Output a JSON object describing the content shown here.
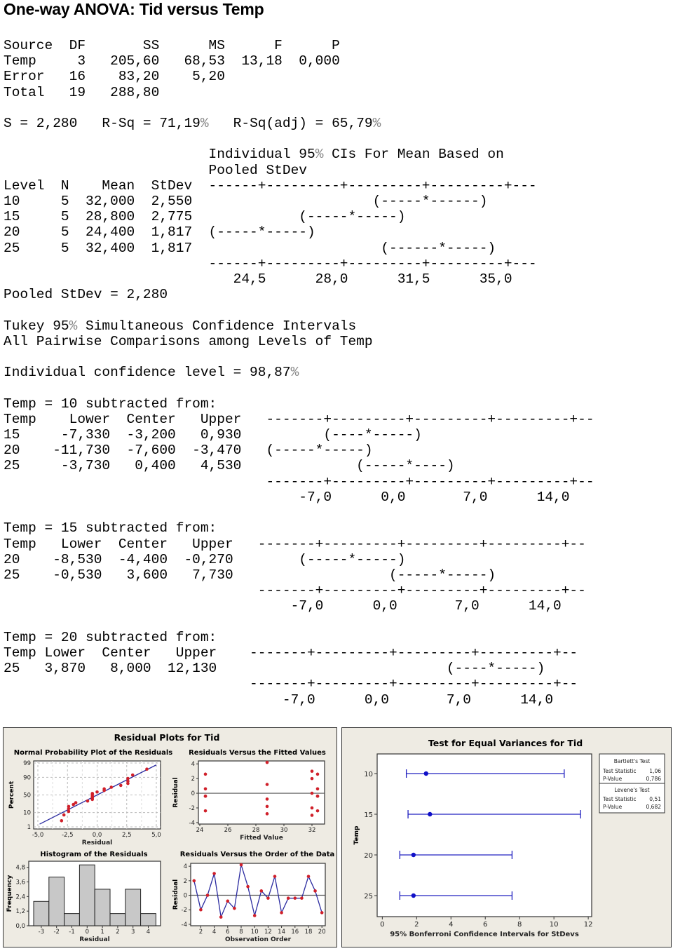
{
  "title": "One-way ANOVA: Tid versus Temp",
  "anova": {
    "header": [
      "Source",
      "DF",
      "SS",
      "MS",
      "F",
      "P"
    ],
    "rows": [
      [
        "Temp",
        "3",
        "205,60",
        "68,53",
        "13,18",
        "0,000"
      ],
      [
        "Error",
        "16",
        "83,20",
        "5,20",
        "",
        ""
      ],
      [
        "Total",
        "19",
        "288,80",
        "",
        "",
        ""
      ]
    ],
    "s_line": "S = 2,280   R-Sq = 71,19%   R-Sq(adj) = 65,79%"
  },
  "levels": {
    "ci_title_1": "Individual 95% CIs For Mean Based on",
    "ci_title_2": "Pooled StDev",
    "header": [
      "Level",
      "N",
      "Mean",
      "StDev"
    ],
    "rows": [
      [
        "10",
        "5",
        "32,000",
        "2,550"
      ],
      [
        "15",
        "5",
        "28,800",
        "2,775"
      ],
      [
        "20",
        "5",
        "24,400",
        "1,817"
      ],
      [
        "25",
        "5",
        "32,400",
        "1,817"
      ]
    ],
    "axis_ticks": [
      "24,5",
      "28,0",
      "31,5",
      "35,0"
    ],
    "pooled": "Pooled StDev = 2,280"
  },
  "tukey": {
    "title_1": "Tukey 95% Simultaneous Confidence Intervals",
    "title_2": "All Pairwise Comparisons among Levels of Temp",
    "individual": "Individual confidence level = 98,87%",
    "axis_ticks": [
      "-7,0",
      "0,0",
      "7,0",
      "14,0"
    ],
    "groups": [
      {
        "label": "Temp = 10 subtracted from:",
        "header": [
          "Temp",
          "Lower",
          "Center",
          "Upper"
        ],
        "rows": [
          [
            "15",
            "-7,330",
            "-3,200",
            "0,930"
          ],
          [
            "20",
            "-11,730",
            "-7,600",
            "-3,470"
          ],
          [
            "25",
            "-3,730",
            "0,400",
            "4,530"
          ]
        ]
      },
      {
        "label": "Temp = 15 subtracted from:",
        "header": [
          "Temp",
          "Lower",
          "Center",
          "Upper"
        ],
        "rows": [
          [
            "20",
            "-8,530",
            "-4,400",
            "-0,270"
          ],
          [
            "25",
            "-0,530",
            "3,600",
            "7,730"
          ]
        ]
      },
      {
        "label": "Temp = 20 subtracted from:",
        "header": [
          "Temp",
          "Lower",
          "Center",
          "Upper"
        ],
        "rows": [
          [
            "25",
            "3,870",
            "8,000",
            "12,130"
          ]
        ]
      }
    ]
  },
  "colors": {
    "point": "#d0202a",
    "line": "#2b2ba0",
    "bar": "#c8c8c8",
    "panel": "#eeebe3",
    "ci": "#2020c0"
  },
  "chart_data": [
    {
      "type": "scatter",
      "title": "Normal Probability Plot of the Residuals",
      "panel_title": "Residual Plots for Tid",
      "xlabel": "Residual",
      "ylabel": "Percent",
      "xticks": [
        "-5,0",
        "-2,5",
        "0,0",
        "2,5",
        "5,0"
      ],
      "yticks": [
        "1",
        "10",
        "50",
        "90",
        "99"
      ],
      "xlim": [
        -5,
        5
      ],
      "residuals": [
        -3.0,
        -2.8,
        -2.4,
        -2.4,
        -2.4,
        -2.0,
        -1.8,
        -0.8,
        -0.4,
        -0.4,
        -0.4,
        -0.4,
        -0.4,
        0.0,
        0.6,
        0.6,
        1.2,
        2.0,
        2.6,
        2.6,
        2.6,
        3.0,
        4.2
      ]
    },
    {
      "type": "scatter",
      "title": "Residuals Versus the Fitted Values",
      "xlabel": "Fitted Value",
      "ylabel": "Residual",
      "xticks": [
        "24",
        "26",
        "28",
        "30",
        "32"
      ],
      "yticks": [
        "4",
        "2",
        "0",
        "-2",
        "-4"
      ],
      "xlim": [
        23.9,
        32.9
      ],
      "ylim": [
        -4.2,
        4.4
      ],
      "points": [
        [
          24.4,
          2.6
        ],
        [
          24.4,
          0.6
        ],
        [
          24.4,
          -0.4
        ],
        [
          24.4,
          -0.4
        ],
        [
          24.4,
          -2.4
        ],
        [
          28.8,
          4.2
        ],
        [
          28.8,
          1.2
        ],
        [
          28.8,
          -0.8
        ],
        [
          28.8,
          -1.8
        ],
        [
          28.8,
          -2.8
        ],
        [
          32.0,
          3.0
        ],
        [
          32.0,
          2.0
        ],
        [
          32.0,
          0.0
        ],
        [
          32.0,
          -2.0
        ],
        [
          32.0,
          -3.0
        ],
        [
          32.4,
          2.6
        ],
        [
          32.4,
          0.6
        ],
        [
          32.4,
          -0.4
        ],
        [
          32.4,
          -0.4
        ],
        [
          32.4,
          -2.4
        ]
      ]
    },
    {
      "type": "bar",
      "title": "Histogram of the Residuals",
      "xlabel": "Residual",
      "ylabel": "Frequency",
      "categories": [
        "-3",
        "-2",
        "-1",
        "0",
        "1",
        "2",
        "3",
        "4"
      ],
      "values": [
        2,
        4,
        1,
        5,
        3,
        1,
        3,
        1
      ],
      "yticks": [
        "0,0",
        "1,2",
        "2,4",
        "3,6",
        "4,8"
      ],
      "ylim": [
        0,
        5.3
      ]
    },
    {
      "type": "line",
      "title": "Residuals Versus the Order of the Data",
      "xlabel": "Observation Order",
      "ylabel": "Residual",
      "xticks": [
        "2",
        "4",
        "6",
        "8",
        "10",
        "12",
        "14",
        "16",
        "18",
        "20"
      ],
      "yticks": [
        "4",
        "2",
        "0",
        "-2",
        "-4"
      ],
      "xlim": [
        0.5,
        20.5
      ],
      "ylim": [
        -4.2,
        4.4
      ],
      "values": [
        2.0,
        -2.0,
        0.0,
        3.0,
        -3.0,
        -0.8,
        -1.8,
        4.2,
        1.2,
        -2.8,
        0.6,
        -0.4,
        2.6,
        -2.4,
        -0.4,
        -0.4,
        -0.4,
        2.6,
        0.6,
        -2.4
      ]
    },
    {
      "type": "interval",
      "title": "Test for Equal Variances for Tid",
      "xlabel": "95% Bonferroni Confidence Intervals for StDevs",
      "ylabel": "Temp",
      "xticks": [
        "0",
        "2",
        "4",
        "6",
        "8",
        "10",
        "12"
      ],
      "xlim": [
        -0.3,
        12.2
      ],
      "categories": [
        "10",
        "15",
        "20",
        "25"
      ],
      "intervals": [
        {
          "low": 1.4,
          "point": 2.55,
          "high": 10.6
        },
        {
          "low": 1.5,
          "point": 2.775,
          "high": 11.55
        },
        {
          "low": 1.02,
          "point": 1.817,
          "high": 7.56
        },
        {
          "low": 1.02,
          "point": 1.817,
          "high": 7.56
        }
      ],
      "legend": {
        "bartlett_title": "Bartlett's Test",
        "bartlett_stat_label": "Test Statistic",
        "bartlett_stat": "1,06",
        "bartlett_p_label": "P-Value",
        "bartlett_p": "0,786",
        "levene_title": "Levene's Test",
        "levene_stat_label": "Test Statistic",
        "levene_stat": "0,51",
        "levene_p_label": "P-Value",
        "levene_p": "0,682"
      }
    }
  ]
}
